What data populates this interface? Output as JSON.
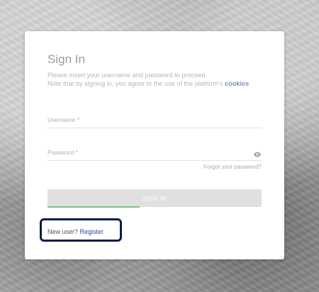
{
  "signin": {
    "title": "Sign In",
    "subtitle_line1": "Please insert your username and password to proceed",
    "subtitle_line2_prefix": "Note that by signing in, you agree to the use of the platform's ",
    "cookies_link": "cookies",
    "username_label": "Username *",
    "password_label": "Password *",
    "forgot_password": "Forgot your password?",
    "signin_button": "SIGN IN",
    "signin_progress_fraction": 0.43,
    "new_user_prefix": "New user? ",
    "register_link": "Register"
  },
  "icons": {
    "password_toggle": "eye-icon"
  },
  "colors": {
    "link": "#2e4a9a",
    "cookies_link": "#7f8ec2",
    "progress": "#7ac97a",
    "highlight_border": "#0d1b4b",
    "button_bg": "#e0e0e0"
  }
}
